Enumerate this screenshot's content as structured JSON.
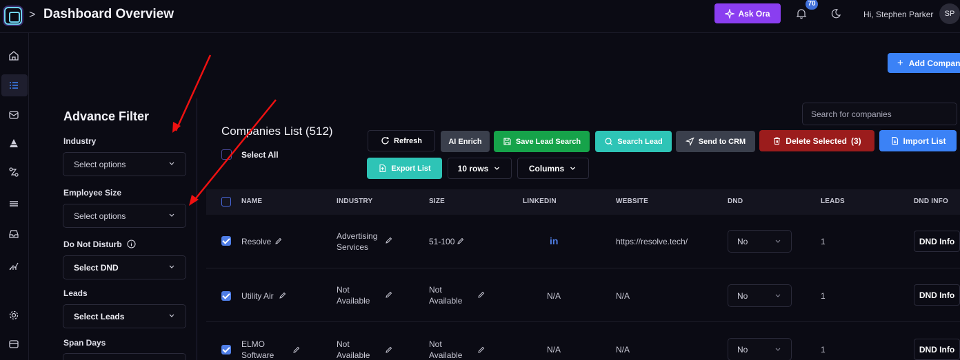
{
  "header": {
    "title": "Dashboard Overview",
    "ask_ora": "Ask Ora",
    "notification_count": "70",
    "greeting": "Hi, Stephen Parker",
    "avatar_initials": "SP"
  },
  "rail_icons": [
    "home-icon",
    "list-icon",
    "mail-icon",
    "pyramid-icon",
    "workflow-icon",
    "menu-icon",
    "inbox-icon",
    "analytics-icon",
    "settings-icon",
    "card-icon"
  ],
  "filter": {
    "title": "Advance Filter",
    "industry_label": "Industry",
    "industry_value": "Select options",
    "employee_label": "Employee Size",
    "employee_value": "Select options",
    "dnd_label": "Do Not Disturb",
    "dnd_value": "Select DND",
    "leads_label": "Leads",
    "leads_value": "Select Leads",
    "span_label": "Span Days"
  },
  "main": {
    "list_title": "Companies List (512)",
    "select_all": "Select All",
    "search_placeholder": "Search for companies",
    "add_company": "Add Company"
  },
  "toolbar": {
    "refresh": "Refresh",
    "ai_enrich": "AI Enrich",
    "save_lead_search": "Save Lead Search",
    "search_lead": "Search Lead",
    "send_to_crm": "Send to CRM",
    "delete_selected": "Delete Selected",
    "delete_count": "(3)",
    "import_list": "Import List",
    "export_list": "Export List",
    "rows": "10 rows",
    "columns": "Columns"
  },
  "colors": {
    "ask_ora": "#8a3ef0",
    "save_lead": "#16a34a",
    "search_lead": "#2ec4b6",
    "delete": "#9b1c1c",
    "primary": "#3b82f6"
  },
  "table": {
    "columns": [
      "NAME",
      "INDUSTRY",
      "SIZE",
      "LINKEDIN",
      "WEBSITE",
      "DND",
      "LEADS",
      "DND INFO"
    ],
    "rows": [
      {
        "name_1": "Resolve",
        "name_2": "",
        "industry_1": "Advertising",
        "industry_2": "Services",
        "size_1": "51-100",
        "size_2": "",
        "linkedin": "in",
        "website": "https://resolve.tech/",
        "dnd": "No",
        "leads": "1",
        "dnd_info": "DND Info"
      },
      {
        "name_1": "Utility Air",
        "name_2": "",
        "industry_1": "Not",
        "industry_2": "Available",
        "size_1": "Not",
        "size_2": "Available",
        "linkedin": "N/A",
        "website": "N/A",
        "dnd": "No",
        "leads": "1",
        "dnd_info": "DND Info"
      },
      {
        "name_1": "ELMO",
        "name_2": "Software",
        "industry_1": "Not",
        "industry_2": "Available",
        "size_1": "Not",
        "size_2": "Available",
        "linkedin": "N/A",
        "website": "N/A",
        "dnd": "No",
        "leads": "1",
        "dnd_info": "DND Info"
      }
    ]
  }
}
